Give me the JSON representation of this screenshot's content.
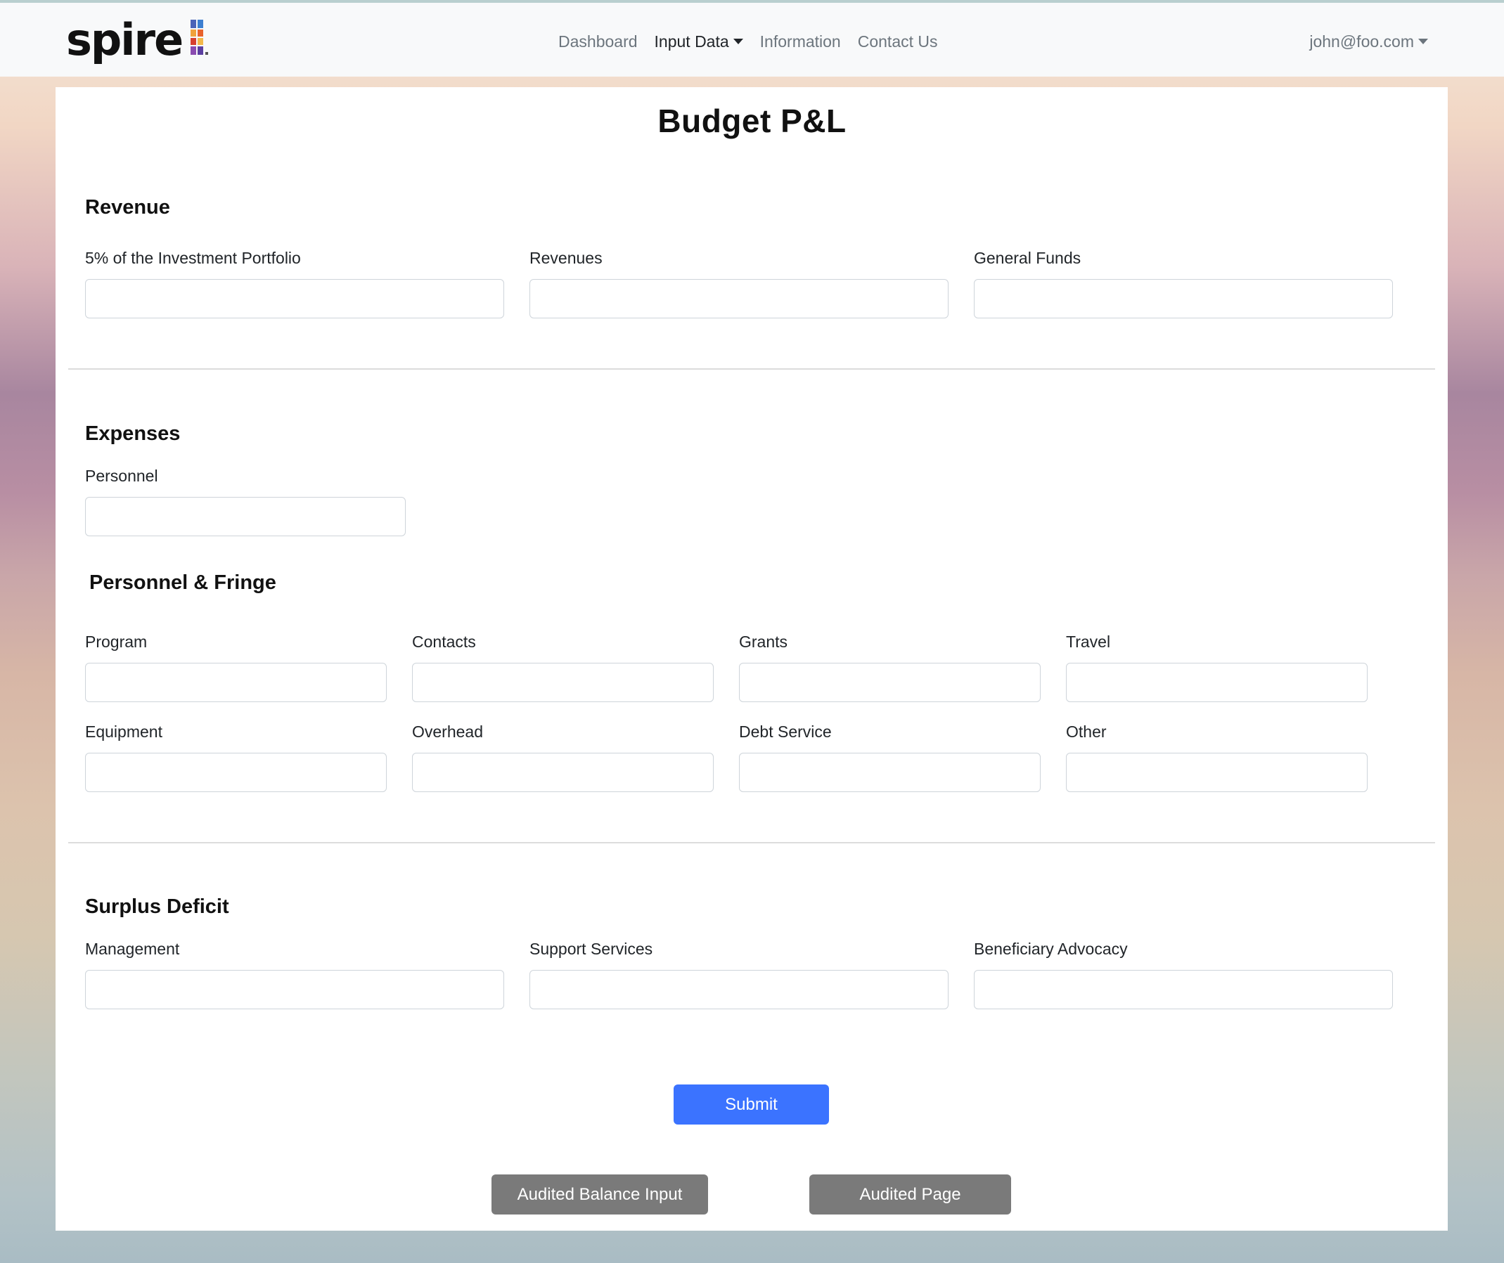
{
  "navbar": {
    "brand": "spire",
    "links": [
      {
        "label": "Dashboard"
      },
      {
        "label": "Input Data"
      },
      {
        "label": "Information"
      },
      {
        "label": "Contact Us"
      }
    ],
    "user": "john@foo.com"
  },
  "page": {
    "title": "Budget P&L"
  },
  "revenue": {
    "title": "Revenue",
    "fields": [
      {
        "label": "5% of the Investment Portfolio",
        "value": ""
      },
      {
        "label": "Revenues",
        "value": ""
      },
      {
        "label": "General Funds",
        "value": ""
      }
    ]
  },
  "expenses": {
    "title": "Expenses",
    "fields": [
      {
        "label": "Personnel",
        "value": ""
      }
    ]
  },
  "personnel_fringe": {
    "title": "Personnel & Fringe",
    "fields": [
      {
        "label": "Program",
        "value": ""
      },
      {
        "label": "Contacts",
        "value": ""
      },
      {
        "label": "Grants",
        "value": ""
      },
      {
        "label": "Travel",
        "value": ""
      },
      {
        "label": "Equipment",
        "value": ""
      },
      {
        "label": "Overhead",
        "value": ""
      },
      {
        "label": "Debt Service",
        "value": ""
      },
      {
        "label": "Other",
        "value": ""
      }
    ]
  },
  "surplus_deficit": {
    "title": "Surplus Deficit",
    "fields": [
      {
        "label": "Management",
        "value": ""
      },
      {
        "label": "Support Services",
        "value": ""
      },
      {
        "label": "Beneficiary Advocacy",
        "value": ""
      }
    ]
  },
  "actions": {
    "submit": "Submit",
    "audited_balance_input": "Audited Balance Input",
    "audited_page": "Audited Page"
  },
  "colors": {
    "primary_button": "#3b73ff",
    "secondary_button": "#7a7a7a",
    "navbar_bg": "#f8f9fa"
  }
}
